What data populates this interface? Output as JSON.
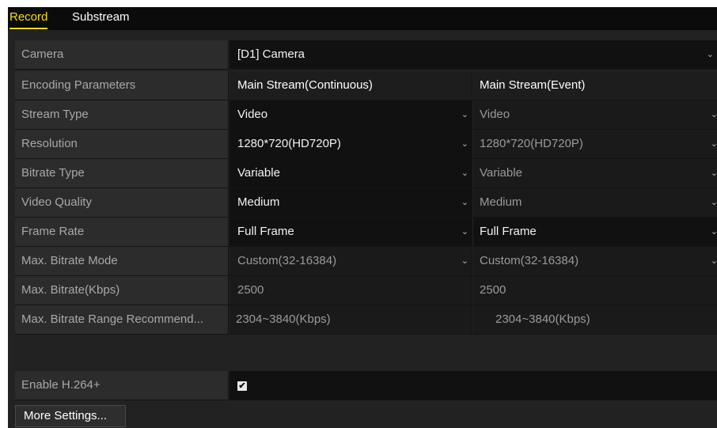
{
  "tabs": {
    "record": "Record",
    "substream": "Substream"
  },
  "camera": {
    "label": "Camera",
    "value": "[D1] Camera"
  },
  "encoding": {
    "label": "Encoding Parameters",
    "col1": "Main Stream(Continuous)",
    "col2": "Main Stream(Event)"
  },
  "rows": [
    {
      "label": "Stream Type",
      "col1": "Video",
      "col2": "Video"
    },
    {
      "label": "Resolution",
      "col1": "1280*720(HD720P)",
      "col2": "1280*720(HD720P)"
    },
    {
      "label": "Bitrate Type",
      "col1": "Variable",
      "col2": "Variable"
    },
    {
      "label": "Video Quality",
      "col1": "Medium",
      "col2": "Medium"
    },
    {
      "label": "Frame Rate",
      "col1": "Full Frame",
      "col2": "Full Frame"
    },
    {
      "label": "Max. Bitrate Mode",
      "col1": "Custom(32-16384)",
      "col2": "Custom(32-16384)"
    },
    {
      "label": "Max. Bitrate(Kbps)",
      "col1": "2500",
      "col2": "2500"
    },
    {
      "label": "Max. Bitrate Range Recommend...",
      "col1": "2304~3840(Kbps)",
      "col2": "2304~3840(Kbps)"
    }
  ],
  "h264plus": {
    "label": "Enable H.264+",
    "checked": true,
    "check_glyph": "✔"
  },
  "more_settings": "More Settings...",
  "dropdown_glyph": "⌄"
}
